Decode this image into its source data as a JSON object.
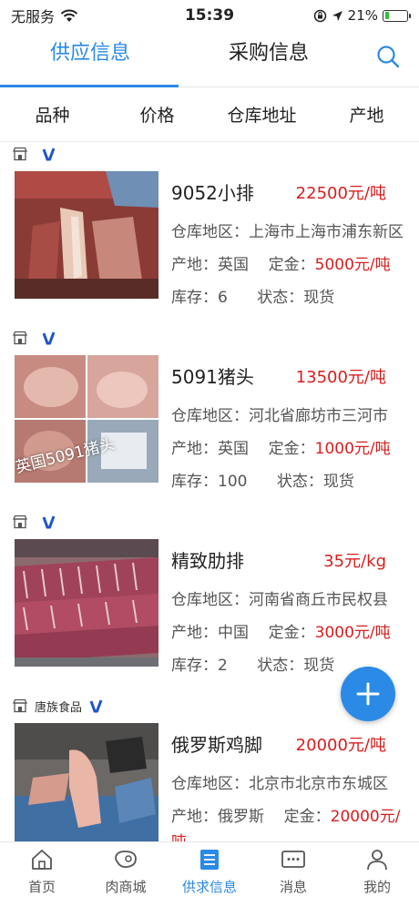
{
  "status_bar": {
    "carrier": "无服务",
    "time": "15:39",
    "battery_percent": "21%",
    "battery_level": 0.21
  },
  "top_tabs": [
    {
      "label": "供应信息",
      "active": true
    },
    {
      "label": "采购信息",
      "active": false
    }
  ],
  "filters": [
    "品种",
    "价格",
    "仓库地址",
    "产地"
  ],
  "listings": [
    {
      "shop_name": "",
      "title": "9052小排",
      "price": "22500元/吨",
      "warehouse_label": "仓库地区：",
      "warehouse": "上海市上海市浦东新区",
      "origin_label": "产地：",
      "origin": "英国",
      "deposit_label": "定金：",
      "deposit": "5000元/吨",
      "stock_label": "库存：",
      "stock": "6",
      "status_label": "状态：",
      "status": "现货",
      "image_caption": ""
    },
    {
      "shop_name": "",
      "title": "5091猪头",
      "price": "13500元/吨",
      "warehouse_label": "仓库地区：",
      "warehouse": "河北省廊坊市三河市",
      "origin_label": "产地：",
      "origin": "英国",
      "deposit_label": "定金：",
      "deposit": "1000元/吨",
      "stock_label": "库存：",
      "stock": "100",
      "status_label": "状态：",
      "status": "现货",
      "image_caption": "英国5091猪头"
    },
    {
      "shop_name": "",
      "title": "精致肋排",
      "price": "35元/kg",
      "warehouse_label": "仓库地区：",
      "warehouse": "河南省商丘市民权县",
      "origin_label": "产地：",
      "origin": "中国",
      "deposit_label": "定金：",
      "deposit": "3000元/吨",
      "stock_label": "库存：",
      "stock": "2",
      "status_label": "状态：",
      "status": "现货",
      "image_caption": ""
    },
    {
      "shop_name": "唐族食品",
      "title": "俄罗斯鸡脚",
      "price": "20000元/吨",
      "warehouse_label": "仓库地区：",
      "warehouse": "北京市北京市东城区",
      "origin_label": "产地：",
      "origin": "俄罗斯",
      "deposit_label": "定金：",
      "deposit": "20000元/",
      "deposit_wrap": "吨",
      "image_caption": ""
    }
  ],
  "bottom_nav": [
    {
      "label": "首页",
      "icon": "home-icon",
      "active": false
    },
    {
      "label": "肉商城",
      "icon": "meat-icon",
      "active": false
    },
    {
      "label": "供求信息",
      "icon": "list-icon",
      "active": true
    },
    {
      "label": "消息",
      "icon": "message-icon",
      "active": false
    },
    {
      "label": "我的",
      "icon": "person-icon",
      "active": false
    }
  ],
  "colors": {
    "accent": "#2b8ae6",
    "price_red": "#d81e1e"
  }
}
